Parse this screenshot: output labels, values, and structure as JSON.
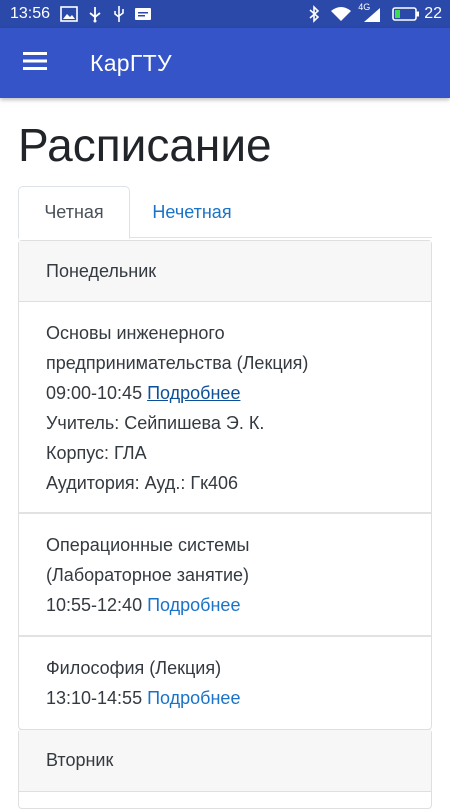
{
  "status_bar": {
    "time": "13:56",
    "network_label": "4G",
    "battery_level": "22",
    "icons": [
      "image-icon",
      "usb-icon",
      "usb-debug-icon",
      "message-icon",
      "bluetooth-icon",
      "wifi-icon",
      "signal-icon",
      "battery-icon"
    ]
  },
  "app_bar": {
    "title": "КарГТУ",
    "menu_icon": "hamburger-menu-icon"
  },
  "page": {
    "title": "Расписание"
  },
  "tabs": [
    {
      "label": "Четная",
      "active": true
    },
    {
      "label": "Нечетная",
      "active": false
    }
  ],
  "days": [
    {
      "name": "Понедельник",
      "lessons": [
        {
          "title_line1": "Основы инженерного",
          "title_line2": "предпринимательства (Лекция)",
          "time": "09:00-10:45",
          "link": "Подробнее",
          "teacher": "Учитель: Сейпишева Э. К.",
          "building": "Корпус: ГЛА",
          "room": "Аудитория: Ауд.: Гк406"
        },
        {
          "title_line1": "Операционные системы",
          "title_line2": "(Лабораторное занятие)",
          "time": "10:55-12:40",
          "link": "Подробнее"
        },
        {
          "title_line1": "Философия (Лекция)",
          "time": "13:10-14:55",
          "link": "Подробнее"
        }
      ]
    },
    {
      "name": "Вторник",
      "lessons": []
    }
  ],
  "colors": {
    "status_bar": "#2b49a9",
    "app_bar": "#3454c7",
    "link": "#1a73c9",
    "link_visited": "#0d4f99"
  }
}
